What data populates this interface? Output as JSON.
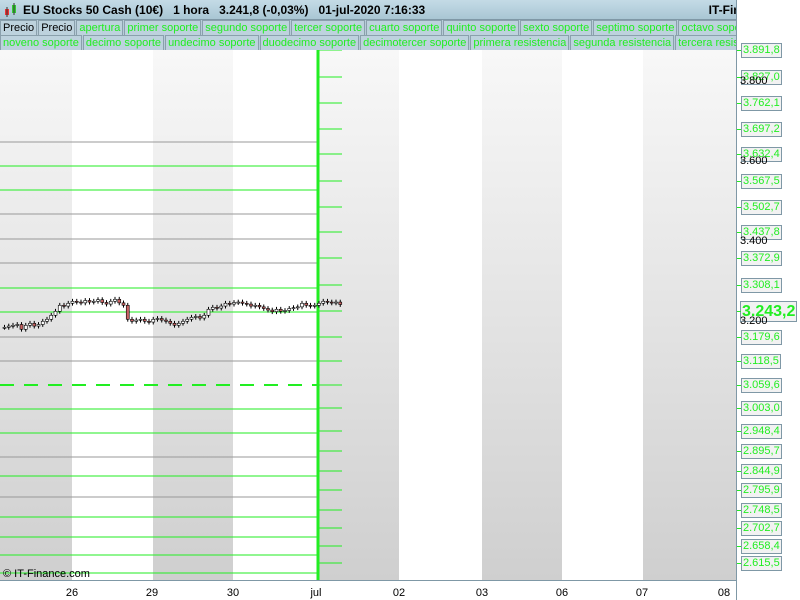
{
  "header": {
    "title": "EU Stocks 50 Cash (10€)   1 hora   3.241,8 (-0,03%)   01-jul-2020 7:16:33",
    "brand": "IT-Finance.com"
  },
  "legend_row1": [
    "Precio",
    "Precio",
    "apertura",
    "primer soporte",
    "segundo soporte",
    "tercer soporte",
    "cuarto soporte",
    "quinto soporte",
    "sexto soporte",
    "septimo soporte",
    "octavo soporte"
  ],
  "legend_row2": [
    "noveno soporte",
    "decimo soporte",
    "undecimo soporte",
    "duodecimo soporte",
    "decimotercer soporte",
    "primera resistencia",
    "segunda resistencia",
    "tercera resistencia"
  ],
  "price_labels": [
    "3.891,8",
    "3.827,0",
    "3.762,1",
    "3.697,2",
    "3.632,4",
    "3.567,5",
    "3.502,7",
    "3.437,8",
    "3.372,9",
    "3.308,1",
    "3.243,2",
    "3.179,6",
    "3.118,5",
    "3.059,6",
    "3.003,0",
    "2.948,4",
    "2.895,7",
    "2.844,9",
    "2.795,9",
    "2.748,5",
    "2.702,7",
    "2.658,4",
    "2.615,5"
  ],
  "current_price": "3.243,2",
  "grid_labels": [
    "3.800",
    "3.600",
    "3.400",
    "3.200"
  ],
  "x_labels": [
    "26",
    "29",
    "30",
    "jul",
    "02",
    "03",
    "06",
    "07",
    "08"
  ],
  "copyright": "© IT-Finance.com",
  "colors": {
    "level": "#22ee22",
    "candle_up": "#ffffff",
    "candle_down": "#c86464"
  },
  "closes": [
    3185,
    3188,
    3190,
    3192,
    3180,
    3190,
    3195,
    3188,
    3192,
    3200,
    3205,
    3215,
    3225,
    3240,
    3238,
    3245,
    3250,
    3248,
    3246,
    3252,
    3248,
    3250,
    3254,
    3247,
    3243,
    3250,
    3255,
    3246,
    3240,
    3205,
    3200,
    3203,
    3205,
    3200,
    3198,
    3205,
    3207,
    3203,
    3200,
    3195,
    3190,
    3195,
    3200,
    3205,
    3210,
    3212,
    3208,
    3215,
    3230,
    3235,
    3233,
    3238,
    3245,
    3243,
    3247,
    3248,
    3245,
    3243,
    3238,
    3240,
    3236,
    3232,
    3228,
    3224,
    3230,
    3225,
    3227,
    3232,
    3234,
    3236,
    3245,
    3240,
    3238,
    3240,
    3245,
    3250,
    3248,
    3246,
    3248,
    3242
  ]
}
